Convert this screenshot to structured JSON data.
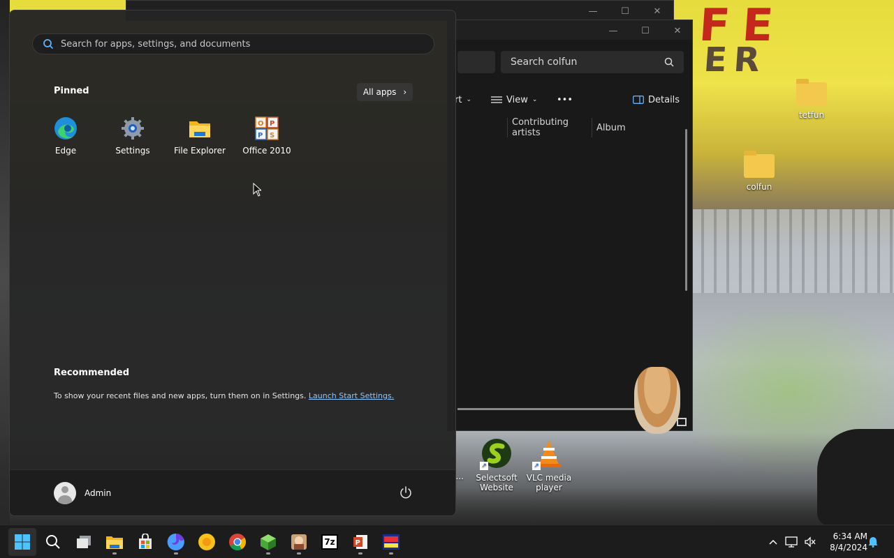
{
  "desktop": {
    "icons": [
      {
        "label": "tetfun"
      },
      {
        "label": "colfun"
      },
      {
        "label": "Selectsoft Website"
      },
      {
        "label": "VLC media player"
      },
      {
        "label": "ft ..."
      }
    ]
  },
  "explorer": {
    "search_placeholder": "Search colfun",
    "toolbar": {
      "sort_label": "rt",
      "view_label": "View",
      "more_label": "•••",
      "details_label": "Details"
    },
    "columns": [
      "Contributing artists",
      "Album"
    ]
  },
  "start_menu": {
    "search_placeholder": "Search for apps, settings, and documents",
    "pinned_title": "Pinned",
    "all_apps_label": "All apps",
    "pinned": [
      {
        "label": "Edge",
        "icon": "edge-icon"
      },
      {
        "label": "Settings",
        "icon": "settings-gear-icon"
      },
      {
        "label": "File Explorer",
        "icon": "folder-icon"
      },
      {
        "label": "Office 2010",
        "icon": "office-icon"
      }
    ],
    "recommended_title": "Recommended",
    "recommended_text": "To show your recent files and new apps, turn them on in Settings.",
    "recommended_link": "Launch Start Settings.",
    "user_name": "Admin"
  },
  "taskbar": {
    "apps": [
      {
        "name": "start",
        "icon": "windows-icon"
      },
      {
        "name": "search",
        "icon": "search-icon"
      },
      {
        "name": "task-view",
        "icon": "task-view-icon"
      },
      {
        "name": "file-explorer",
        "icon": "folder-icon"
      },
      {
        "name": "store",
        "icon": "store-icon"
      },
      {
        "name": "firefox",
        "icon": "firefox-icon"
      },
      {
        "name": "app-yellow",
        "icon": "yellow-circle-icon"
      },
      {
        "name": "chrome",
        "icon": "chrome-icon"
      },
      {
        "name": "cube-app",
        "icon": "cube-icon"
      },
      {
        "name": "game-app",
        "icon": "game-icon"
      },
      {
        "name": "7zip",
        "icon": "7z-icon",
        "text": "7z"
      },
      {
        "name": "powerpoint",
        "icon": "powerpoint-icon"
      },
      {
        "name": "pclu",
        "icon": "pclu-icon"
      }
    ],
    "time": "6:34 AM",
    "date": "8/4/2024"
  },
  "colors": {
    "start_bg": "#242424",
    "accent_link": "#8fc6ff",
    "taskbar_bg": "#1c1c1c"
  }
}
